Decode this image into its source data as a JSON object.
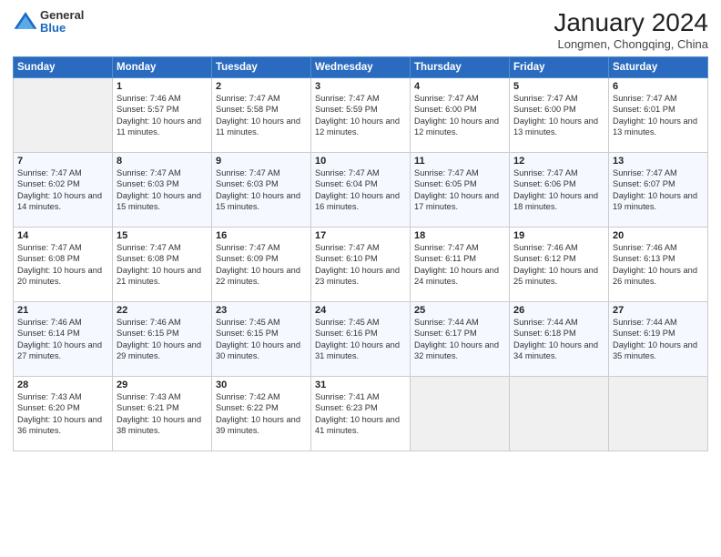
{
  "logo": {
    "general": "General",
    "blue": "Blue"
  },
  "header": {
    "month_title": "January 2024",
    "location": "Longmen, Chongqing, China"
  },
  "days_of_week": [
    "Sunday",
    "Monday",
    "Tuesday",
    "Wednesday",
    "Thursday",
    "Friday",
    "Saturday"
  ],
  "weeks": [
    [
      {
        "day": "",
        "empty": true
      },
      {
        "day": "1",
        "sunrise": "7:46 AM",
        "sunset": "5:57 PM",
        "daylight": "10 hours and 11 minutes."
      },
      {
        "day": "2",
        "sunrise": "7:47 AM",
        "sunset": "5:58 PM",
        "daylight": "10 hours and 11 minutes."
      },
      {
        "day": "3",
        "sunrise": "7:47 AM",
        "sunset": "5:59 PM",
        "daylight": "10 hours and 12 minutes."
      },
      {
        "day": "4",
        "sunrise": "7:47 AM",
        "sunset": "6:00 PM",
        "daylight": "10 hours and 12 minutes."
      },
      {
        "day": "5",
        "sunrise": "7:47 AM",
        "sunset": "6:00 PM",
        "daylight": "10 hours and 13 minutes."
      },
      {
        "day": "6",
        "sunrise": "7:47 AM",
        "sunset": "6:01 PM",
        "daylight": "10 hours and 13 minutes."
      }
    ],
    [
      {
        "day": "7",
        "sunrise": "7:47 AM",
        "sunset": "6:02 PM",
        "daylight": "10 hours and 14 minutes."
      },
      {
        "day": "8",
        "sunrise": "7:47 AM",
        "sunset": "6:03 PM",
        "daylight": "10 hours and 15 minutes."
      },
      {
        "day": "9",
        "sunrise": "7:47 AM",
        "sunset": "6:03 PM",
        "daylight": "10 hours and 15 minutes."
      },
      {
        "day": "10",
        "sunrise": "7:47 AM",
        "sunset": "6:04 PM",
        "daylight": "10 hours and 16 minutes."
      },
      {
        "day": "11",
        "sunrise": "7:47 AM",
        "sunset": "6:05 PM",
        "daylight": "10 hours and 17 minutes."
      },
      {
        "day": "12",
        "sunrise": "7:47 AM",
        "sunset": "6:06 PM",
        "daylight": "10 hours and 18 minutes."
      },
      {
        "day": "13",
        "sunrise": "7:47 AM",
        "sunset": "6:07 PM",
        "daylight": "10 hours and 19 minutes."
      }
    ],
    [
      {
        "day": "14",
        "sunrise": "7:47 AM",
        "sunset": "6:08 PM",
        "daylight": "10 hours and 20 minutes."
      },
      {
        "day": "15",
        "sunrise": "7:47 AM",
        "sunset": "6:08 PM",
        "daylight": "10 hours and 21 minutes."
      },
      {
        "day": "16",
        "sunrise": "7:47 AM",
        "sunset": "6:09 PM",
        "daylight": "10 hours and 22 minutes."
      },
      {
        "day": "17",
        "sunrise": "7:47 AM",
        "sunset": "6:10 PM",
        "daylight": "10 hours and 23 minutes."
      },
      {
        "day": "18",
        "sunrise": "7:47 AM",
        "sunset": "6:11 PM",
        "daylight": "10 hours and 24 minutes."
      },
      {
        "day": "19",
        "sunrise": "7:46 AM",
        "sunset": "6:12 PM",
        "daylight": "10 hours and 25 minutes."
      },
      {
        "day": "20",
        "sunrise": "7:46 AM",
        "sunset": "6:13 PM",
        "daylight": "10 hours and 26 minutes."
      }
    ],
    [
      {
        "day": "21",
        "sunrise": "7:46 AM",
        "sunset": "6:14 PM",
        "daylight": "10 hours and 27 minutes."
      },
      {
        "day": "22",
        "sunrise": "7:46 AM",
        "sunset": "6:15 PM",
        "daylight": "10 hours and 29 minutes."
      },
      {
        "day": "23",
        "sunrise": "7:45 AM",
        "sunset": "6:15 PM",
        "daylight": "10 hours and 30 minutes."
      },
      {
        "day": "24",
        "sunrise": "7:45 AM",
        "sunset": "6:16 PM",
        "daylight": "10 hours and 31 minutes."
      },
      {
        "day": "25",
        "sunrise": "7:44 AM",
        "sunset": "6:17 PM",
        "daylight": "10 hours and 32 minutes."
      },
      {
        "day": "26",
        "sunrise": "7:44 AM",
        "sunset": "6:18 PM",
        "daylight": "10 hours and 34 minutes."
      },
      {
        "day": "27",
        "sunrise": "7:44 AM",
        "sunset": "6:19 PM",
        "daylight": "10 hours and 35 minutes."
      }
    ],
    [
      {
        "day": "28",
        "sunrise": "7:43 AM",
        "sunset": "6:20 PM",
        "daylight": "10 hours and 36 minutes."
      },
      {
        "day": "29",
        "sunrise": "7:43 AM",
        "sunset": "6:21 PM",
        "daylight": "10 hours and 38 minutes."
      },
      {
        "day": "30",
        "sunrise": "7:42 AM",
        "sunset": "6:22 PM",
        "daylight": "10 hours and 39 minutes."
      },
      {
        "day": "31",
        "sunrise": "7:41 AM",
        "sunset": "6:23 PM",
        "daylight": "10 hours and 41 minutes."
      },
      {
        "day": "",
        "empty": true
      },
      {
        "day": "",
        "empty": true
      },
      {
        "day": "",
        "empty": true
      }
    ]
  ],
  "labels": {
    "sunrise_prefix": "Sunrise: ",
    "sunset_prefix": "Sunset: ",
    "daylight_prefix": "Daylight: "
  }
}
